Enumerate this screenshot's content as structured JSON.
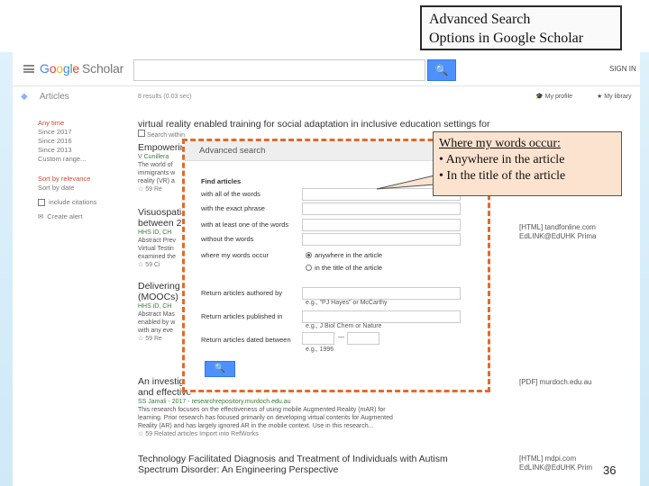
{
  "slide": {
    "title_line1": "Advanced Search",
    "title_line2": "Options in Google Scholar",
    "page_number": "36"
  },
  "callout": {
    "heading": "Where my words occur:",
    "item1": "• Anywhere in the article",
    "item2": "• In the title of the article"
  },
  "header": {
    "logo": {
      "g1": "G",
      "g2": "o",
      "g3": "o",
      "g4": "g",
      "g5": "l",
      "g6": "e",
      "product": "Scholar"
    },
    "search_icon": "🔍",
    "signin": "SIGN IN"
  },
  "subheader": {
    "section": "Articles",
    "results": "8 results (0.03 sec)",
    "my_profile": "My profile",
    "my_library": "My library"
  },
  "sidebar": {
    "time_filters": [
      "Any time",
      "Since 2017",
      "Since 2016",
      "Since 2013",
      "Custom range..."
    ],
    "sort_filters": [
      "Sort by relevance",
      "Sort by date"
    ],
    "include_citations": "include citations",
    "create_alert": "Create alert"
  },
  "results": {
    "query_echo": "virtual reality enabled training for social adaptation in inclusive education settings for",
    "search_within": "Search within",
    "r1": {
      "title": "Empowerin",
      "meta": "V Cunillera",
      "snip1": "The world of",
      "snip2": "immigrants w",
      "snip3": "reality (VR) a",
      "links": "☆ 59 Re"
    },
    "r2": {
      "title": "Visuospatia",
      "title2": "between 2",
      "meta": "HHS iD, CH",
      "snip1": "Abstract Prev",
      "snip2": "Virtual Testin",
      "snip3": "examined the",
      "links": "☆ 59 Ci"
    },
    "r3": {
      "title": "Delivering",
      "title2": "(MOOCs)",
      "meta": "HHS iD, CH",
      "snip1": "Abstract Mas",
      "snip2": "enabled by w",
      "snip3": "with any eve",
      "links": "☆ 59 Re"
    },
    "r4": {
      "title": "An investig",
      "title2": "and effective",
      "meta": "SS Jamali - 2017 - researchrepository.murdoch.edu.au",
      "snip1": "This research focuses on the effectiveness of using mobile Augmented Reality (mAR) for",
      "snip2": "learning. Prior research has focused primarily on developing virtual contents for Augmented",
      "snip3": "Reality (AR) and has largely ignored AR in the mobile context. Use in this research...",
      "links": "☆ 59 Related articles Import into RefWorks"
    },
    "r5": {
      "title": "Technology Facilitated Diagnosis and Treatment of Individuals with Autism",
      "title2": "Spectrum Disorder: An Engineering Perspective"
    }
  },
  "right_links": {
    "l1a": "[HTML] tandfonline.com",
    "l1b": "EdLINK@EdUHK Prima",
    "l2": "[PDF] murdoch.edu.au",
    "l3a": "[HTML] mdpi.com",
    "l3b": "EdLINK@EdUHK Prim"
  },
  "advanced": {
    "title": "Advanced search",
    "find_articles": "Find articles",
    "all_words": "with all of the words",
    "exact_phrase": "with the exact phrase",
    "at_least_one": "with at least one of the words",
    "without_words": "without the words",
    "where_occur": "where my words occur",
    "opt_anywhere": "anywhere in the article",
    "opt_title": "in the title of the article",
    "authored_by": "Return articles authored by",
    "authored_example": "e.g., \"PJ Hayes\" or McCarthy",
    "published_in": "Return articles published in",
    "published_example": "e.g., J Biol Chem or Nature",
    "dated_between": "Return articles dated between",
    "dated_sep": "—",
    "dated_example": "e.g., 1996",
    "search_icon": "🔍"
  }
}
